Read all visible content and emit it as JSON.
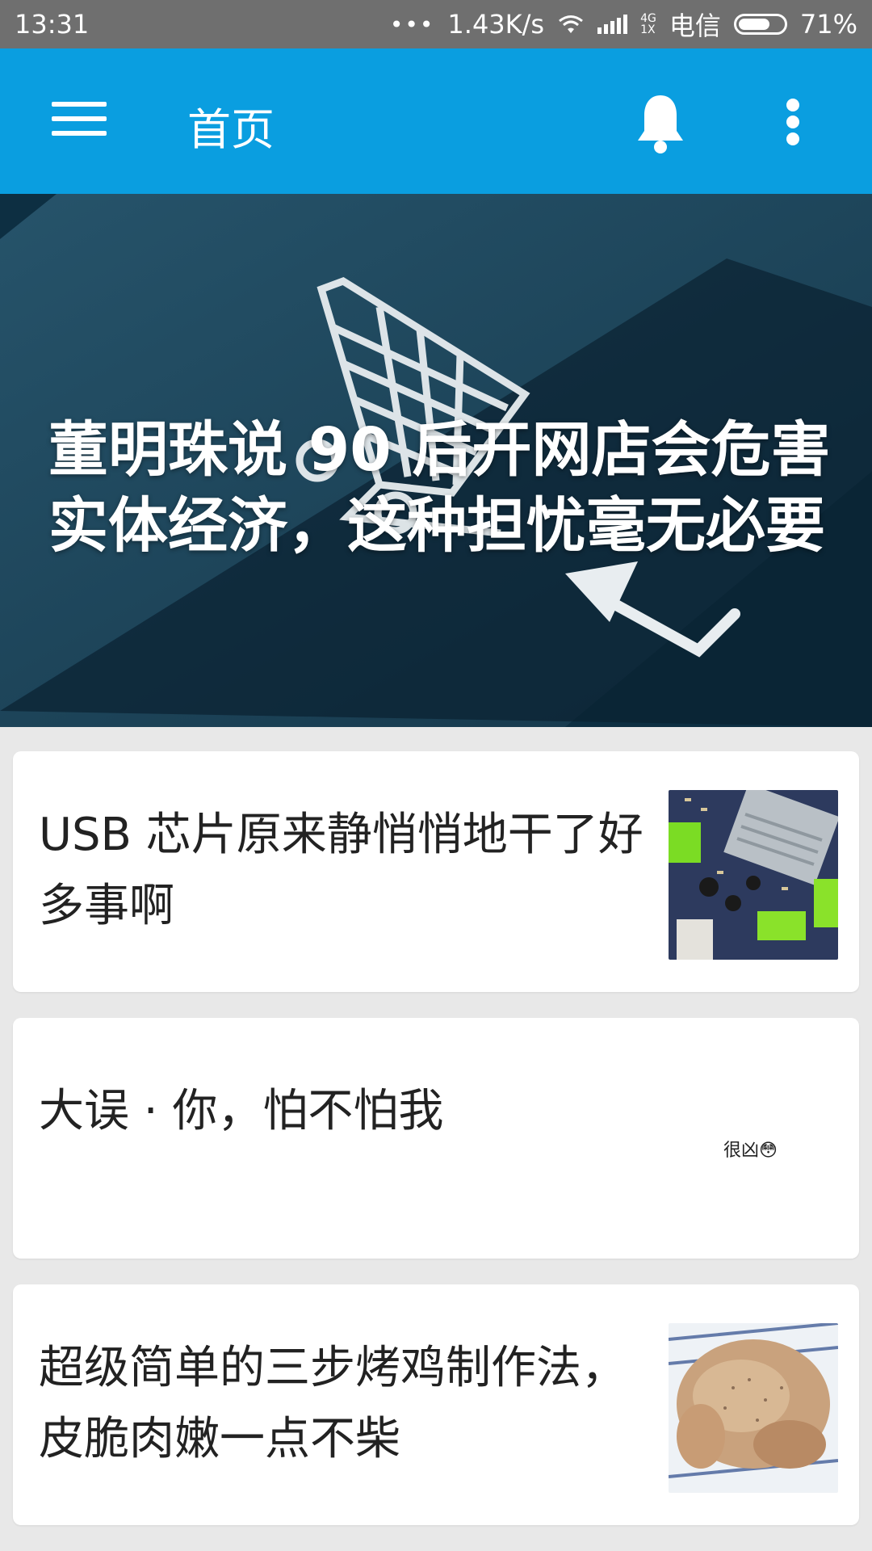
{
  "status_bar": {
    "time": "13:31",
    "speed": "1.43K/s",
    "net_top": "4G",
    "net_bottom": "1X",
    "carrier": "电信",
    "battery": "71%",
    "battery_level": 0.71,
    "more_dots": "•••"
  },
  "app_bar": {
    "title": "首页",
    "icons": [
      "menu-icon",
      "bell-icon",
      "more-vert-icon"
    ]
  },
  "banner": {
    "title": "董明珠说 90 后开网店会危害实体经济，这种担忧毫无必要",
    "dots_count": 5,
    "active_index": 1
  },
  "articles": [
    {
      "title": "USB 芯片原来静悄悄地干了好多事啊"
    },
    {
      "title": "大误 · 你，怕不怕我",
      "thumb_text": "很凶😳"
    },
    {
      "title": "超级简单的三步烤鸡制作法，皮脆肉嫩一点不柴"
    }
  ],
  "colors": {
    "primary": "#0a9ee0",
    "status_bar": "#6f6f6f",
    "background": "#e8e8e8",
    "dot_active": "#1e88e5"
  }
}
